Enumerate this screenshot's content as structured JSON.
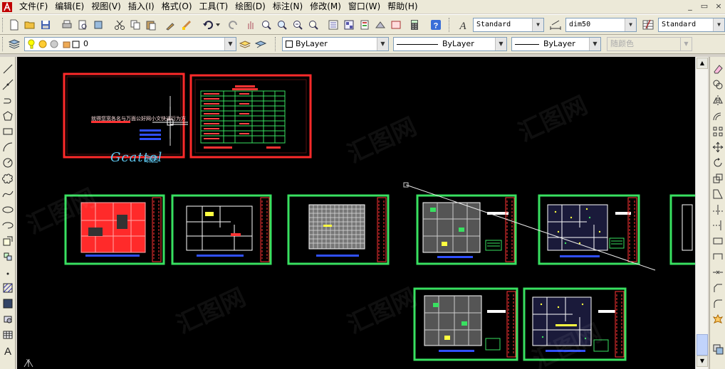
{
  "menu": {
    "items": [
      {
        "label": "文件(F)"
      },
      {
        "label": "编辑(E)"
      },
      {
        "label": "视图(V)"
      },
      {
        "label": "插入(I)"
      },
      {
        "label": "格式(O)"
      },
      {
        "label": "工具(T)"
      },
      {
        "label": "绘图(D)"
      },
      {
        "label": "标注(N)"
      },
      {
        "label": "修改(M)"
      },
      {
        "label": "窗口(W)"
      },
      {
        "label": "帮助(H)"
      }
    ],
    "window_controls": [
      "_",
      "▭",
      "×"
    ]
  },
  "styles_toolbar": {
    "text_style": "Standard",
    "dim_style": "dim50",
    "table_style": "Standard"
  },
  "properties_toolbar": {
    "layer": "0",
    "color": "ByLayer",
    "linetype": "ByLayer",
    "lineweight": "ByLayer",
    "plot_style": "随颜色"
  },
  "drawing": {
    "logo_text": "Gcattol",
    "logo_sub": "纸图",
    "tagline": "就得您宽各名与万面公好网小文快通行为方",
    "watermark": "汇图网",
    "ucs_label": "Y",
    "colors": {
      "background": "#000000",
      "frame_red": "#ff2a2a",
      "frame_green": "#38e060",
      "title_cyan": "#5ec8f0",
      "plan_blue": "#3050ff",
      "plan_red": "#ff3333"
    }
  },
  "icons": {
    "app": "autocad-app-icon",
    "text_style": "text-style-icon",
    "dim_style": "dim-style-icon",
    "table_style": "table-style-icon"
  }
}
